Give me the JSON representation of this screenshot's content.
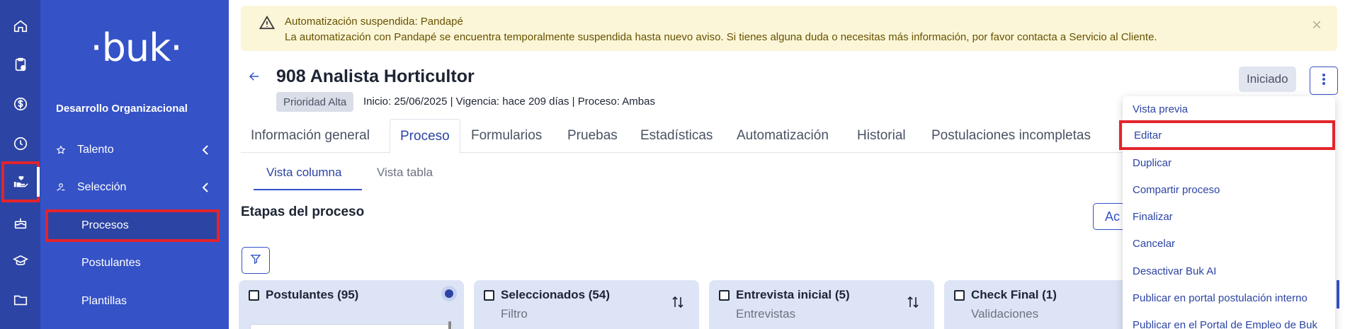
{
  "rail": {
    "icons": [
      "home-icon",
      "clipboard-icon",
      "dollar-icon",
      "clock-icon",
      "hand-heart-icon",
      "cake-icon",
      "graduation-cap-icon",
      "folder-icon"
    ]
  },
  "sidebar": {
    "logo": "·buk·",
    "section_title": "Desarrollo Organizacional",
    "items": [
      {
        "label": "Talento",
        "icon": "star-icon"
      },
      {
        "label": "Selección",
        "icon": "person-hand-icon"
      }
    ],
    "subitems": [
      {
        "label": "Procesos"
      },
      {
        "label": "Postulantes"
      },
      {
        "label": "Plantillas"
      }
    ]
  },
  "alert": {
    "title": "Automatización suspendida: Pandapé",
    "body": "La automatización con Pandapé se encuentra temporalmente suspendida hasta nuevo aviso. Si tienes alguna duda o necesitas más información, por favor contacta a Servicio al Cliente.",
    "close": "×"
  },
  "header": {
    "title": "908 Analista Horticultor",
    "priority": "Prioridad Alta",
    "meta": "Inicio: 25/06/2025  | Vigencia: hace 209 días  | Proceso: Ambas",
    "status": "Iniciado"
  },
  "tabs": [
    {
      "label": "Información general"
    },
    {
      "label": "Proceso"
    },
    {
      "label": "Formularios"
    },
    {
      "label": "Pruebas"
    },
    {
      "label": "Estadísticas"
    },
    {
      "label": "Automatización"
    },
    {
      "label": "Historial"
    },
    {
      "label": "Postulaciones incompletas"
    }
  ],
  "view_tabs": [
    {
      "label": "Vista columna"
    },
    {
      "label": "Vista tabla"
    }
  ],
  "section": {
    "title": "Etapas del proceso",
    "action_button": "Ac"
  },
  "columns": [
    {
      "title": "Postulantes (95)",
      "subtitle": ""
    },
    {
      "title": "Seleccionados (54)",
      "subtitle": "Filtro"
    },
    {
      "title": "Entrevista inicial (5)",
      "subtitle": "Entrevistas"
    },
    {
      "title": "Check Final (1)",
      "subtitle": "Validaciones"
    }
  ],
  "dropdown": {
    "items": [
      {
        "label": "Vista previa"
      },
      {
        "label": "Editar"
      },
      {
        "label": "Duplicar"
      },
      {
        "label": "Compartir proceso"
      },
      {
        "label": "Finalizar"
      },
      {
        "label": "Cancelar"
      },
      {
        "label": "Desactivar Buk AI"
      },
      {
        "label": "Publicar en portal postulación interno"
      },
      {
        "label": "Publicar en el Portal de Empleo de Buk"
      }
    ]
  },
  "colors": {
    "sidebar": "#3552c7",
    "rail": "#2c44a4",
    "accent": "#2c44a4",
    "highlight": "#e3242b",
    "alert_bg": "#fcf6d8"
  }
}
